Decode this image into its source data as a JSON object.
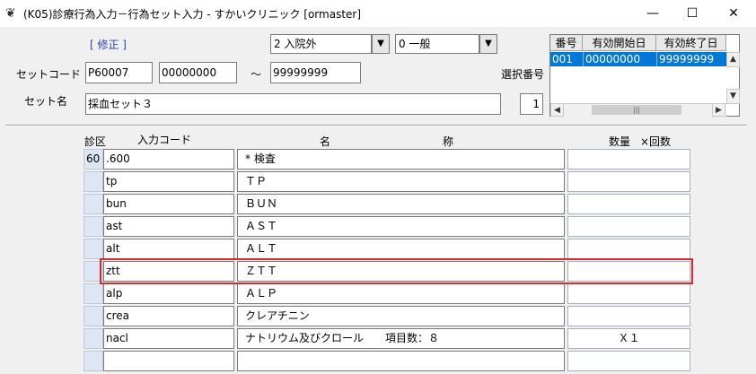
{
  "window": {
    "title": "(K05)診療行為入力－行為セット入力 - すかいクリニック [ormaster]",
    "minimize": "—",
    "maximize": "☐",
    "close": "✕"
  },
  "form": {
    "mode_label": "[ 修正 ]",
    "setcode_label": "セットコード",
    "setcode_value": "P60007",
    "range_from": "00000000",
    "range_tilde": "～",
    "range_to": "99999999",
    "setname_label": "セット名",
    "setname_value": "採血セット３",
    "inpatient_combo": "2 入院外",
    "general_combo": "0 一般",
    "select_number_label": "選択番号",
    "select_number_value": "1"
  },
  "history": {
    "headers": [
      "番号",
      "有効開始日",
      "有効終了日"
    ],
    "rows": [
      [
        "001",
        "00000000",
        "99999999"
      ]
    ]
  },
  "grid": {
    "headers": {
      "kubun": "診区",
      "code": "入力コード",
      "name_left": "名",
      "name_right": "称",
      "qty": "数量",
      "times": "×回数"
    },
    "rows": [
      {
        "kubun": "60",
        "code": ".600",
        "name": "* 検査",
        "qty": ""
      },
      {
        "kubun": "",
        "code": "tp",
        "name": "ＴＰ",
        "qty": ""
      },
      {
        "kubun": "",
        "code": "bun",
        "name": "ＢＵＮ",
        "qty": ""
      },
      {
        "kubun": "",
        "code": "ast",
        "name": "ＡＳＴ",
        "qty": ""
      },
      {
        "kubun": "",
        "code": "alt",
        "name": "ＡＬＴ",
        "qty": ""
      },
      {
        "kubun": "",
        "code": "ztt",
        "name": "ＺＴＴ",
        "qty": ""
      },
      {
        "kubun": "",
        "code": "alp",
        "name": "ＡＬＰ",
        "qty": ""
      },
      {
        "kubun": "",
        "code": "crea",
        "name": "クレアチニン",
        "qty": ""
      },
      {
        "kubun": "",
        "code": "nacl",
        "name": "ナトリウム及びクロール　　項目数：８",
        "qty": "Ｘ１"
      },
      {
        "kubun": "",
        "code": "",
        "name": "",
        "qty": ""
      }
    ]
  },
  "colors": {
    "selection": "#0078d7",
    "highlight_border": "#e0262e",
    "mode_text": "#2a3fbf"
  }
}
